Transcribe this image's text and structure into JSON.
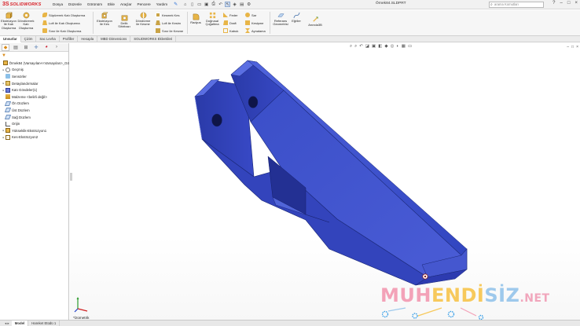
{
  "app": {
    "logo_mark": "3S",
    "logo_text": "SOLIDWORKS",
    "menu": [
      "Dosya",
      "Düzenle",
      "Görünüm",
      "Ekle",
      "Araçlar",
      "Pencere",
      "Yardım"
    ],
    "document_title": "Örnek84.SLDPRT",
    "search_placeholder": "arama Komutları",
    "window_controls": [
      "?",
      "–",
      "□",
      "×"
    ]
  },
  "ribbon": {
    "extrude_boss": "Ekstrüzyon ile Katı Oluşturma",
    "revolve_boss": "Döndürerek Katı Oluşturma",
    "sweep_boss": "Süpürerek Katı Oluşturma",
    "loft_boss": "Loft ile Katı Oluşturma",
    "boundary_boss": "Sınır ile Katı Oluşturma",
    "extrude_cut": "Ekstrüzyon ile Kes",
    "hole_wizard": "Delik Sihirbazı",
    "revolve_cut": "Döndürme ile Kesme",
    "sweep_cut": "Kesmek Kes",
    "loft_cut": "Loft ile Kesim",
    "boundary_cut": "Sınır ile Kesme",
    "fillet": "Radyus",
    "linear_pattern": "Doğrusal Çoğaltma",
    "rib": "Feder",
    "draft": "Draft",
    "shell": "Kabuk",
    "wrap": "Sar",
    "intersect": "Kesişme",
    "mirror": "Aynalama",
    "reference_geometry": "Referans Geometrisi",
    "curves": "Eğriler",
    "instant3d": "Anında3B"
  },
  "tabs": [
    "Unsurlar",
    "Çizim",
    "Sac Levha",
    "Profiller",
    "Hesapla",
    "MBD Dimensions",
    "SOLIDWORKS Eklentileri"
  ],
  "active_tab": "Unsurlar",
  "feature_tree": [
    {
      "label": "Örnek84  (Varsayılan<<Varsayılan>_Gö",
      "icon": "part-icon",
      "expand": ""
    },
    {
      "label": "Geçmiş",
      "icon": "history-icon",
      "expand": "▸"
    },
    {
      "label": "Sensörler",
      "icon": "sensor-icon",
      "expand": ""
    },
    {
      "label": "Detaylandırmalar",
      "icon": "annotation-icon",
      "expand": "▸"
    },
    {
      "label": "Katı Gövdeler(1)",
      "icon": "solid-body-icon",
      "expand": "▸"
    },
    {
      "label": "Malzeme <belirli değil>",
      "icon": "material-icon",
      "expand": ""
    },
    {
      "label": "Ön Düzlem",
      "icon": "plane-icon",
      "expand": ""
    },
    {
      "label": "Üst Düzlem",
      "icon": "plane-icon",
      "expand": ""
    },
    {
      "label": "Sağ Düzlem",
      "icon": "plane-icon",
      "expand": ""
    },
    {
      "label": "Orijin",
      "icon": "origin-icon",
      "expand": ""
    },
    {
      "label": "Yükseklik-Ekstrüzyon1",
      "icon": "extrude-icon",
      "expand": "▸"
    },
    {
      "label": "Kes-Ekstrüzyon2",
      "icon": "cut-extrude-icon",
      "expand": "▸"
    }
  ],
  "viewport": {
    "view_label": "*İzometrik"
  },
  "watermark": {
    "part1": "MUH",
    "part2": "ENDİ",
    "part3": "SİZ",
    "part4": ".NET"
  },
  "bottom_tabs": [
    "Model",
    "Hareket Etüdü 1"
  ],
  "colors": {
    "part_blue": "#3d4fc4",
    "accent_red": "#d81f26",
    "selection_blue": "#cfdcee"
  }
}
